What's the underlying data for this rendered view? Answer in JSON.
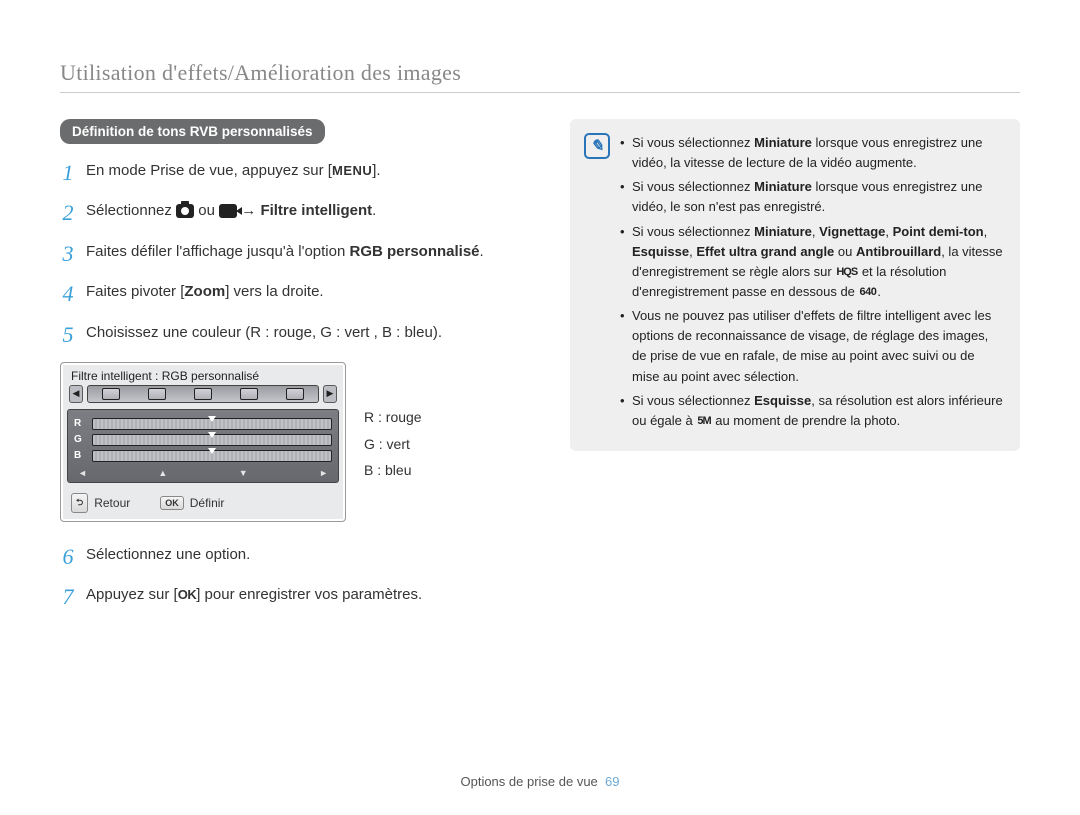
{
  "header": {
    "title": "Utilisation d'effets/Amélioration des images"
  },
  "section": {
    "heading": "Définition de tons RVB personnalisés"
  },
  "steps": {
    "s1": {
      "num": "1",
      "t1": "En mode Prise de vue, appuyez sur [",
      "menu": "MENU",
      "t2": "]."
    },
    "s2": {
      "num": "2",
      "t1": "Sélectionnez ",
      "or": " ou ",
      "arrow": " → ",
      "filter": "Filtre intelligent",
      "end": "."
    },
    "s3": {
      "num": "3",
      "t1": "Faites défiler l'affichage jusqu'à l'option ",
      "rgb": "RGB personnalisé",
      "end": "."
    },
    "s4": {
      "num": "4",
      "t1": "Faites pivoter [",
      "zoom": "Zoom",
      "t2": "] vers la droite."
    },
    "s5": {
      "num": "5",
      "text": "Choisissez une couleur (R : rouge, G : vert , B : bleu)."
    },
    "s6": {
      "num": "6",
      "text": "Sélectionnez une option."
    },
    "s7": {
      "num": "7",
      "t1": "Appuyez sur [",
      "ok": "OK",
      "t2": "] pour enregistrer vos paramètres."
    }
  },
  "panel": {
    "title": "Filtre intelligent : RGB personnalisé",
    "rows": {
      "r": "R",
      "g": "G",
      "b": "B"
    },
    "nav": {
      "left": "◄",
      "up": "▲",
      "down": "▼",
      "right": "►"
    },
    "footer": {
      "back_key": "⮌",
      "back": "Retour",
      "ok_key": "OK",
      "set": "Définir"
    }
  },
  "legend": {
    "r": "R : rouge",
    "g": "G : vert",
    "b": "B : bleu"
  },
  "info": {
    "i1": {
      "a": "Si vous sélectionnez ",
      "b": "Miniature",
      "c": " lorsque vous enregistrez une vidéo, la vitesse de lecture de la vidéo augmente."
    },
    "i2": {
      "a": "Si vous sélectionnez ",
      "b": "Miniature",
      "c": " lorsque vous enregistrez une vidéo, le son n'est pas enregistré."
    },
    "i3": {
      "a": "Si vous sélectionnez ",
      "b": "Miniature",
      "comma1": ", ",
      "c": "Vignettage",
      "comma2": ", ",
      "d": "Point demi-ton",
      "comma3": ", ",
      "e": "Esquisse",
      "comma4": ", ",
      "f": "Effet ultra grand angle",
      "or": " ou ",
      "g": "Antibrouillard",
      "tail1": ", la vitesse d'enregistrement se règle alors sur ",
      "icon1": "HQS",
      "tail2": " et la résolution d'enregistrement passe en dessous de ",
      "icon2": "640",
      "end": "."
    },
    "i4": "Vous ne pouvez pas utiliser d'effets de filtre intelligent avec les options de reconnaissance de visage, de réglage des images, de prise de vue en rafale, de mise au point avec suivi ou de mise au point avec sélection.",
    "i5": {
      "a": "Si vous sélectionnez ",
      "b": "Esquisse",
      "c": ", sa résolution est alors inférieure ou égale à ",
      "icon": "5M",
      "d": " au moment de prendre la photo."
    }
  },
  "footer": {
    "label": "Options de prise de vue",
    "page": "69"
  }
}
